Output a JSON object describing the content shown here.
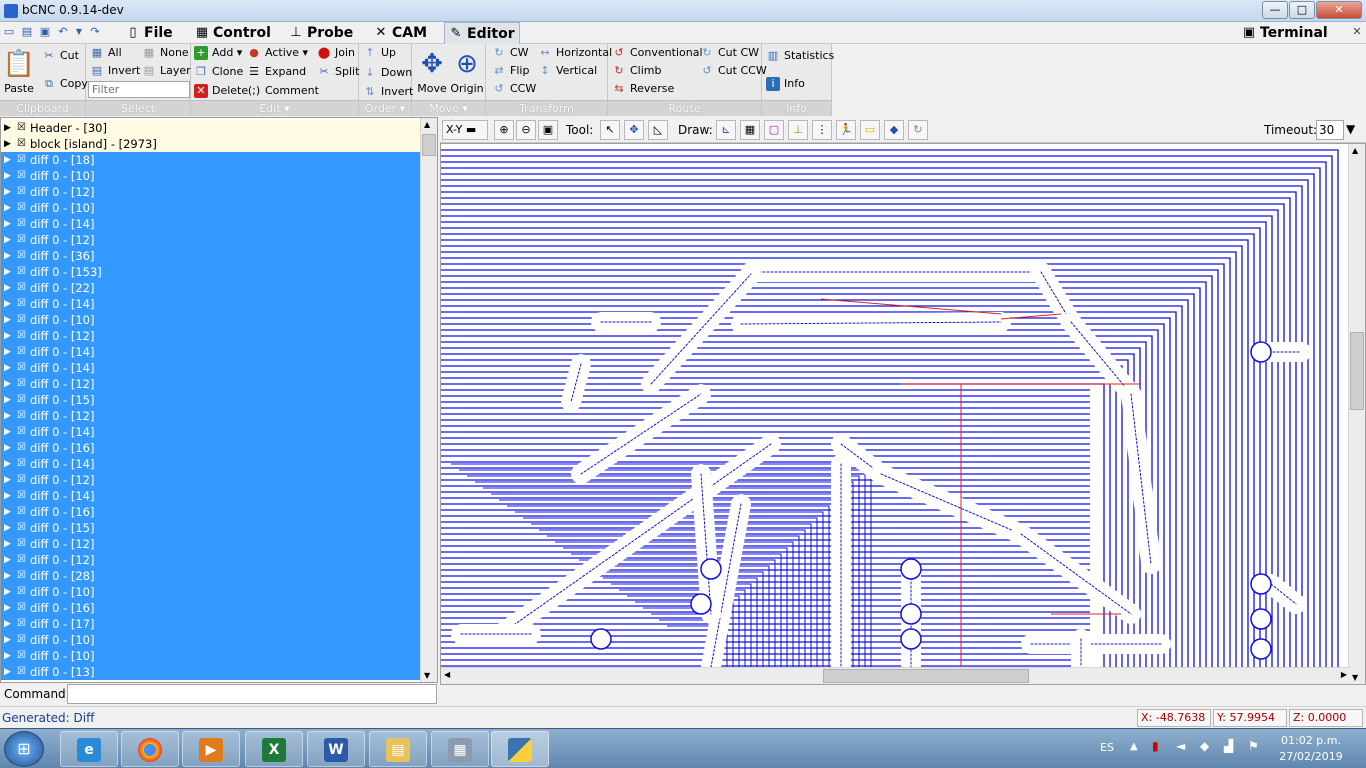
{
  "window": {
    "title": "bCNC 0.9.14-dev",
    "minimize": "—",
    "maximize": "□",
    "close": "✕"
  },
  "menu": {
    "tabs": [
      {
        "label": "File",
        "icon": "file-icon"
      },
      {
        "label": "Control",
        "icon": "control-icon"
      },
      {
        "label": "Probe",
        "icon": "probe-icon"
      },
      {
        "label": "CAM",
        "icon": "cam-icon"
      },
      {
        "label": "Editor",
        "icon": "editor-icon"
      }
    ],
    "active_tab": "Editor",
    "terminal": "Terminal"
  },
  "ribbon": {
    "clipboard": {
      "label": "Clipboard",
      "paste": "Paste",
      "cut": "Cut",
      "copy": "Copy"
    },
    "select": {
      "label": "Select",
      "all": "All",
      "none": "None",
      "invert": "Invert",
      "layer": "Layer",
      "filter_placeholder": "Filter"
    },
    "edit": {
      "label": "Edit ▾",
      "add": "Add ▾",
      "active": "Active ▾",
      "join": "Join",
      "clone": "Clone",
      "expand": "Expand",
      "split": "Split",
      "delete": "Delete",
      "comment": "Comment"
    },
    "order": {
      "label": "Order ▾",
      "up": "Up",
      "down": "Down",
      "invert": "Invert"
    },
    "move": {
      "label": "Move ▾",
      "move": "Move",
      "origin": "Origin"
    },
    "transform": {
      "label": "Transform",
      "cw": "CW",
      "horizontal": "Horizontal",
      "flip": "Flip",
      "vertical": "Vertical",
      "ccw": "CCW"
    },
    "route": {
      "label": "Route",
      "conventional": "Conventional",
      "cut_cw": "Cut CW",
      "climb": "Climb",
      "cut_ccw": "Cut CCW",
      "reverse": "Reverse"
    },
    "info": {
      "label": "Info",
      "statistics": "Statistics",
      "info": "Info"
    }
  },
  "tree": {
    "header": "Header - [30]",
    "block": "block [island] - [2973]",
    "items": [
      "diff 0 - [18]",
      "diff 0 - [10]",
      "diff 0 - [12]",
      "diff 0 - [10]",
      "diff 0 - [14]",
      "diff 0 - [12]",
      "diff 0 - [36]",
      "diff 0 - [153]",
      "diff 0 - [22]",
      "diff 0 - [14]",
      "diff 0 - [10]",
      "diff 0 - [12]",
      "diff 0 - [14]",
      "diff 0 - [14]",
      "diff 0 - [12]",
      "diff 0 - [15]",
      "diff 0 - [12]",
      "diff 0 - [14]",
      "diff 0 - [16]",
      "diff 0 - [14]",
      "diff 0 - [12]",
      "diff 0 - [14]",
      "diff 0 - [16]",
      "diff 0 - [15]",
      "diff 0 - [12]",
      "diff 0 - [12]",
      "diff 0 - [28]",
      "diff 0 - [10]",
      "diff 0 - [16]",
      "diff 0 - [17]",
      "diff 0 - [10]",
      "diff 0 - [10]",
      "diff 0 - [13]"
    ]
  },
  "canvas_toolbar": {
    "view": "X-Y",
    "tool_label": "Tool:",
    "draw_label": "Draw:",
    "timeout_label": "Timeout:",
    "timeout_value": "30"
  },
  "command": {
    "label": "Command:"
  },
  "status": {
    "generated": "Generated: Diff",
    "x": "X: -48.7638",
    "y": "Y: 57.9954",
    "z": "Z: 0.0000"
  },
  "taskbar": {
    "lang": "ES",
    "time": "01:02 p.m.",
    "date": "27/02/2019",
    "apps": [
      "start",
      "internet-explorer",
      "chrome",
      "media-player",
      "excel",
      "word",
      "file-explorer",
      "calculator",
      "python"
    ]
  }
}
